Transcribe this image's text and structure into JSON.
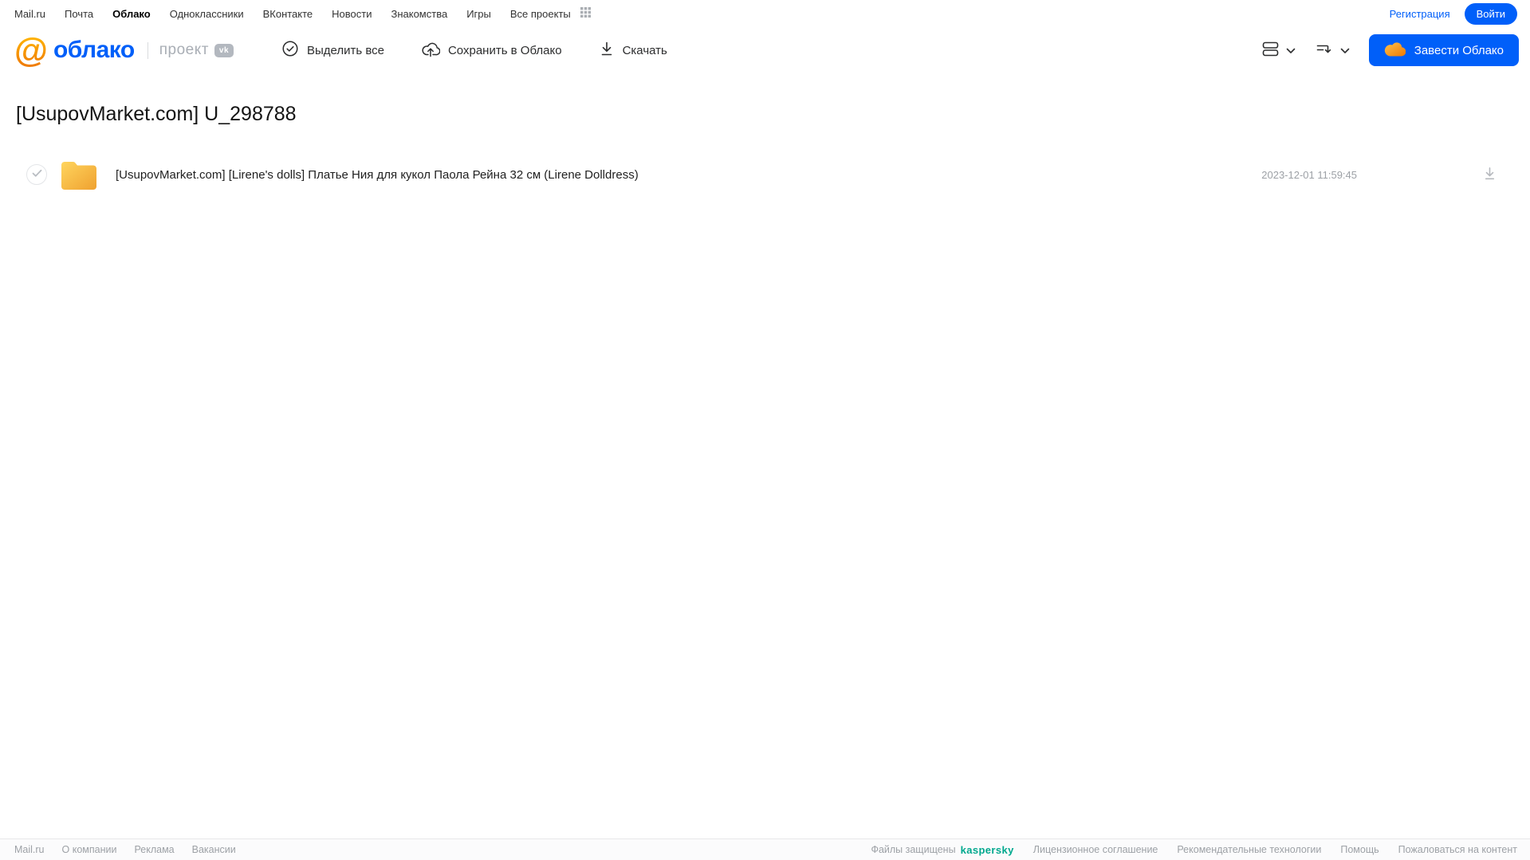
{
  "portal_nav": {
    "items": [
      "Mail.ru",
      "Почта",
      "Облако",
      "Одноклассники",
      "ВКонтакте",
      "Новости",
      "Знакомства",
      "Игры",
      "Все проекты"
    ],
    "active_item": "Облако",
    "registration_label": "Регистрация",
    "login_label": "Войти"
  },
  "header": {
    "logo_text": "облако",
    "project_label": "проект",
    "vk_badge": "vk",
    "toolbar": {
      "select_all_label": "Выделить все",
      "save_to_cloud_label": "Сохранить в Облако",
      "download_label": "Скачать"
    },
    "get_cloud_label": "Завести Облако"
  },
  "main": {
    "title": "[UsupovMarket.com] U_298788",
    "files": [
      {
        "type": "folder",
        "name": "[UsupovMarket.com] [Lirene's dolls] Платье Ния для кукол Паола Рейна 32 см (Lirene Dolldress)",
        "modified": "2023-12-01 11:59:45"
      }
    ]
  },
  "footer": {
    "left_links": [
      "Mail.ru",
      "О компании",
      "Реклама",
      "Вакансии"
    ],
    "protected_text": "Файлы защищены",
    "kaspersky_label": "kaspersky",
    "right_links": [
      "Лицензионное соглашение",
      "Рекомендательные технологии",
      "Помощь",
      "Пожаловаться на контент"
    ]
  },
  "icons": {
    "at-logo-icon": "@",
    "apps-grid-icon": "3x3-square-grid",
    "select-all-icon": "check-circle",
    "save-to-cloud-icon": "cloud-arrow-up",
    "download-icon": "arrow-down-to-line",
    "view-toggle-icon": "stacked-rows",
    "sort-icon": "lines-arrow-down",
    "chevron-down-icon": "chevron-down",
    "cloud-icon": "orange-cloud",
    "folder-icon": "yellow-folder",
    "checkbox-check-icon": "check"
  },
  "colors": {
    "brand_blue": "#005ff9",
    "logo_orange": "#ff9e00",
    "folder_yellow": "#f5b63c",
    "kaspersky_green": "#00a88e",
    "muted_gray": "#9da1a6"
  }
}
